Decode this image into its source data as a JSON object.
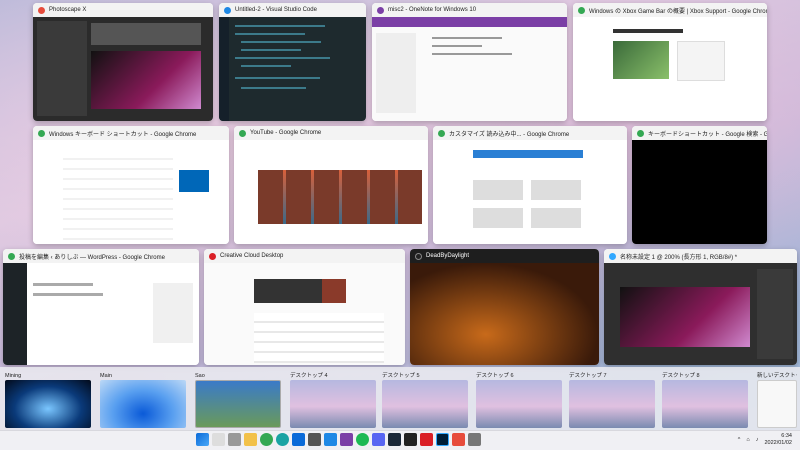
{
  "windows": [
    {
      "title": "Photoscape X",
      "icon": "photoscape-icon",
      "color": "#e74c3c"
    },
    {
      "title": "Untitled-2 - Visual Studio Code",
      "icon": "vscode-icon",
      "color": "#1e88e5"
    },
    {
      "title": "misc2 - OneNote for Windows 10",
      "icon": "onenote-icon",
      "color": "#7b3fa6"
    },
    {
      "title": "Windows の Xbox Game Bar の概要 | Xbox Support - Google Chrome",
      "icon": "chrome-icon",
      "color": "#34a853"
    },
    {
      "title": "Windows キーボード ショートカット - Google Chrome",
      "icon": "chrome-icon",
      "color": "#34a853"
    },
    {
      "title": "YouTube - Google Chrome",
      "icon": "chrome-icon",
      "color": "#34a853"
    },
    {
      "title": "カスタマイズ 読み込み中... - Google Chrome",
      "icon": "chrome-icon",
      "color": "#34a853"
    },
    {
      "title": "キーボードショートカット - Google 検索 - Google Chrome",
      "icon": "chrome-icon",
      "color": "#34a853"
    },
    {
      "title": "投稿を編集 ‹ ありしぶ — WordPress - Google Chrome",
      "icon": "chrome-icon",
      "color": "#34a853"
    },
    {
      "title": "Creative Cloud Desktop",
      "icon": "creative-cloud-icon",
      "color": "#da1f26"
    },
    {
      "title": "DeadByDaylight",
      "icon": "game-icon",
      "color": "#222222"
    },
    {
      "title": "名称未設定 1 @ 200% (長方形 1, RGB/8#) *",
      "icon": "photoshop-icon",
      "color": "#31a8ff"
    }
  ],
  "desktops": [
    {
      "label": "Mining"
    },
    {
      "label": "Main"
    },
    {
      "label": "Sao"
    },
    {
      "label": "デスクトップ 4"
    },
    {
      "label": "デスクトップ 5"
    },
    {
      "label": "デスクトップ 6"
    },
    {
      "label": "デスクトップ 7"
    },
    {
      "label": "デスクトップ 8"
    },
    {
      "label": "新しいデスクトップ"
    }
  ],
  "clock": {
    "time": "6:34",
    "date": "2022/01/02"
  }
}
